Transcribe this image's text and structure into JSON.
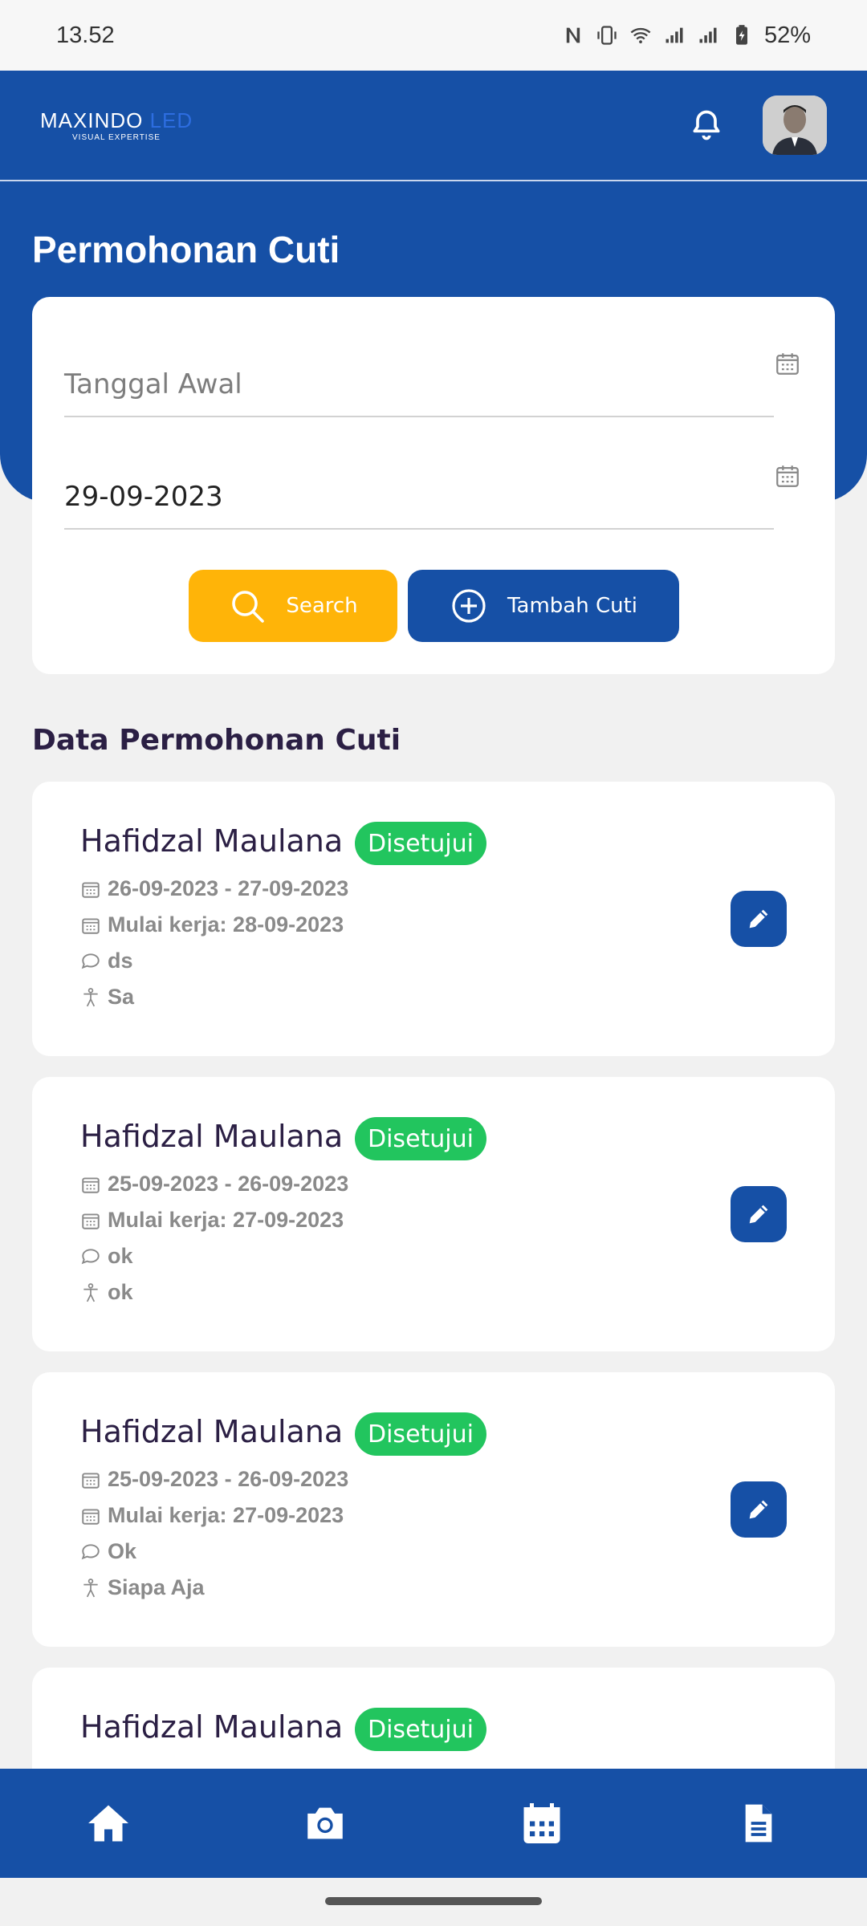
{
  "status_bar": {
    "time": "13.52",
    "battery": "52%"
  },
  "header": {
    "logo_main": "MAXINDO",
    "logo_led": "LED",
    "logo_sub": "VISUAL EXPERTISE"
  },
  "page": {
    "title": "Permohonan Cuti"
  },
  "filter": {
    "start_date_placeholder": "Tanggal Awal",
    "end_date_value": "29-09-2023",
    "search_label": "Search",
    "add_label": "Tambah Cuti"
  },
  "list": {
    "title": "Data Permohonan Cuti",
    "items": [
      {
        "name": "Hafidzal Maulana",
        "status": "Disetujui",
        "range": "26-09-2023 - 27-09-2023",
        "resume": "Mulai kerja: 28-09-2023",
        "note": "ds",
        "substitute": "Sa"
      },
      {
        "name": "Hafidzal Maulana",
        "status": "Disetujui",
        "range": "25-09-2023 - 26-09-2023",
        "resume": "Mulai kerja: 27-09-2023",
        "note": "ok",
        "substitute": "ok"
      },
      {
        "name": "Hafidzal Maulana",
        "status": "Disetujui",
        "range": "25-09-2023 - 26-09-2023",
        "resume": "Mulai kerja: 27-09-2023",
        "note": "Ok",
        "substitute": "Siapa Aja"
      },
      {
        "name": "Hafidzal Maulana",
        "status": "Disetujui"
      }
    ]
  },
  "colors": {
    "primary": "#1650a6",
    "accent": "#ffb408",
    "success": "#22c55e"
  },
  "icons": {
    "nav": [
      "home-icon",
      "camera-icon",
      "calendar-icon",
      "document-icon"
    ]
  }
}
